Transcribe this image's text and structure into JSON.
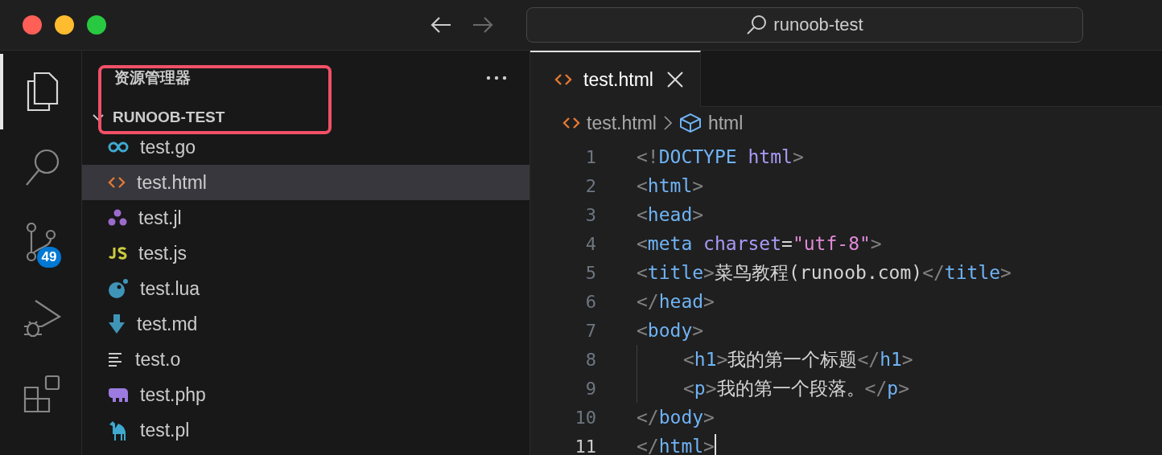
{
  "window": {
    "nav": [
      {
        "kind": "back",
        "disabled": false
      },
      {
        "kind": "forward",
        "disabled": true
      }
    ],
    "search": {
      "value": "runoob-test"
    }
  },
  "activity_bar": [
    {
      "kind": "explorer",
      "selected": true
    },
    {
      "kind": "search",
      "selected": false
    },
    {
      "kind": "source-control",
      "selected": false,
      "badge": "49"
    },
    {
      "kind": "debug",
      "selected": false
    },
    {
      "kind": "extensions",
      "selected": false
    }
  ],
  "sidebar": {
    "title": "资源管理器",
    "folder": {
      "name": "RUNOOB-TEST",
      "expanded": true
    },
    "files": [
      {
        "name": "test.go",
        "kind": "go",
        "selected": false
      },
      {
        "name": "test.html",
        "kind": "html",
        "selected": true
      },
      {
        "name": "test.jl",
        "kind": "julia",
        "selected": false
      },
      {
        "name": "test.js",
        "kind": "js",
        "selected": false
      },
      {
        "name": "test.lua",
        "kind": "lua",
        "selected": false
      },
      {
        "name": "test.md",
        "kind": "md",
        "selected": false
      },
      {
        "name": "test.o",
        "kind": "text",
        "selected": false
      },
      {
        "name": "test.php",
        "kind": "php",
        "selected": false
      },
      {
        "name": "test.pl",
        "kind": "perl",
        "selected": false
      }
    ]
  },
  "tabs": [
    {
      "label": "test.html",
      "kind": "html",
      "selected": true
    }
  ],
  "breadcrumb": [
    {
      "label": "test.html",
      "kind": "html"
    },
    {
      "label": "html",
      "kind": "element"
    }
  ],
  "editor": {
    "lines": [
      {
        "number": "1",
        "current": false,
        "indented": false,
        "tokens": [
          {
            "kind": "punct",
            "t": "<!"
          },
          {
            "kind": "tag",
            "t": "DOCTYPE"
          },
          {
            "kind": "attr",
            "t": " html"
          },
          {
            "kind": "punct",
            "t": ">"
          }
        ]
      },
      {
        "number": "2",
        "current": false,
        "indented": false,
        "tokens": [
          {
            "kind": "punct",
            "t": "<"
          },
          {
            "kind": "tag",
            "t": "html"
          },
          {
            "kind": "punct",
            "t": ">"
          }
        ]
      },
      {
        "number": "3",
        "current": false,
        "indented": false,
        "tokens": [
          {
            "kind": "punct",
            "t": "<"
          },
          {
            "kind": "tag",
            "t": "head"
          },
          {
            "kind": "punct",
            "t": ">"
          }
        ]
      },
      {
        "number": "4",
        "current": false,
        "indented": false,
        "tokens": [
          {
            "kind": "punct",
            "t": "<"
          },
          {
            "kind": "tag",
            "t": "meta"
          },
          {
            "kind": "attr",
            "t": " charset"
          },
          {
            "kind": "text",
            "t": "="
          },
          {
            "kind": "string",
            "t": "\"utf-8\""
          },
          {
            "kind": "punct",
            "t": ">"
          }
        ]
      },
      {
        "number": "5",
        "current": false,
        "indented": false,
        "tokens": [
          {
            "kind": "punct",
            "t": "<"
          },
          {
            "kind": "tag",
            "t": "title"
          },
          {
            "kind": "punct",
            "t": ">"
          },
          {
            "kind": "text",
            "t": "菜鸟教程(runoob.com)"
          },
          {
            "kind": "punct",
            "t": "</"
          },
          {
            "kind": "tag",
            "t": "title"
          },
          {
            "kind": "punct",
            "t": ">"
          }
        ]
      },
      {
        "number": "6",
        "current": false,
        "indented": false,
        "tokens": [
          {
            "kind": "punct",
            "t": "</"
          },
          {
            "kind": "tag",
            "t": "head"
          },
          {
            "kind": "punct",
            "t": ">"
          }
        ]
      },
      {
        "number": "7",
        "current": false,
        "indented": false,
        "tokens": [
          {
            "kind": "punct",
            "t": "<"
          },
          {
            "kind": "tag",
            "t": "body"
          },
          {
            "kind": "punct",
            "t": ">"
          }
        ]
      },
      {
        "number": "8",
        "current": false,
        "indented": true,
        "tokens": [
          {
            "kind": "punct",
            "t": "<"
          },
          {
            "kind": "tag",
            "t": "h1"
          },
          {
            "kind": "punct",
            "t": ">"
          },
          {
            "kind": "text",
            "t": "我的第一个标题"
          },
          {
            "kind": "punct",
            "t": "</"
          },
          {
            "kind": "tag",
            "t": "h1"
          },
          {
            "kind": "punct",
            "t": ">"
          }
        ]
      },
      {
        "number": "9",
        "current": false,
        "indented": true,
        "tokens": [
          {
            "kind": "punct",
            "t": "<"
          },
          {
            "kind": "tag",
            "t": "p"
          },
          {
            "kind": "punct",
            "t": ">"
          },
          {
            "kind": "text",
            "t": "我的第一个段落。"
          },
          {
            "kind": "punct",
            "t": "</"
          },
          {
            "kind": "tag",
            "t": "p"
          },
          {
            "kind": "punct",
            "t": ">"
          }
        ]
      },
      {
        "number": "10",
        "current": false,
        "indented": false,
        "tokens": [
          {
            "kind": "punct",
            "t": "</"
          },
          {
            "kind": "tag",
            "t": "body"
          },
          {
            "kind": "punct",
            "t": ">"
          }
        ]
      },
      {
        "number": "11",
        "current": true,
        "indented": false,
        "tokens": [
          {
            "kind": "punct",
            "t": "</"
          },
          {
            "kind": "tag",
            "t": "html"
          },
          {
            "kind": "punct",
            "t": ">"
          }
        ]
      }
    ]
  }
}
